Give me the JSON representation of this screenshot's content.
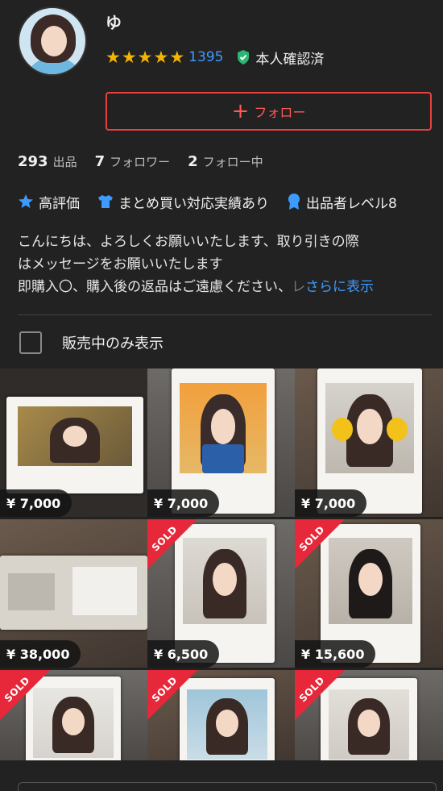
{
  "profile": {
    "username": "ゆ",
    "rating_stars": 5,
    "rating_count": "1395",
    "verified_label": "本人確認済"
  },
  "follow_button": {
    "label": "フォロー"
  },
  "stats": [
    {
      "num": "293",
      "label": "出品"
    },
    {
      "num": "7",
      "label": "フォロワー"
    },
    {
      "num": "2",
      "label": "フォロー中"
    }
  ],
  "badges": [
    {
      "label": "高評価",
      "icon": "star-icon"
    },
    {
      "label": "まとめ買い対応実績あり",
      "icon": "shirt-icon"
    },
    {
      "label": "出品者レベル8",
      "icon": "medal-icon"
    }
  ],
  "bio": {
    "line1": "こんにちは、よろしくお願いいたします、取り引きの際",
    "line2": "はメッセージをお願いいたします",
    "line3": "即購入〇、購入後の返品はご遠慮ください、",
    "line3_fade": "レ",
    "more_label": "さらに表示"
  },
  "filter": {
    "label": "販売中のみ表示",
    "checked": false
  },
  "items": [
    {
      "price": "¥ 7,000",
      "sold": false
    },
    {
      "price": "¥ 7,000",
      "sold": false
    },
    {
      "price": "¥ 7,000",
      "sold": false
    },
    {
      "price": "¥ 38,000",
      "sold": false
    },
    {
      "price": "¥ 6,500",
      "sold": true
    },
    {
      "price": "¥ 15,600",
      "sold": true
    },
    {
      "price": "",
      "sold": true
    },
    {
      "price": "",
      "sold": true
    },
    {
      "price": "",
      "sold": true
    }
  ],
  "sold_label": "SOLD",
  "colors": {
    "accent": "#e8403f",
    "link": "#3d9bff",
    "star": "#f5b400",
    "verified": "#2bb673",
    "sold": "#e6283a"
  }
}
